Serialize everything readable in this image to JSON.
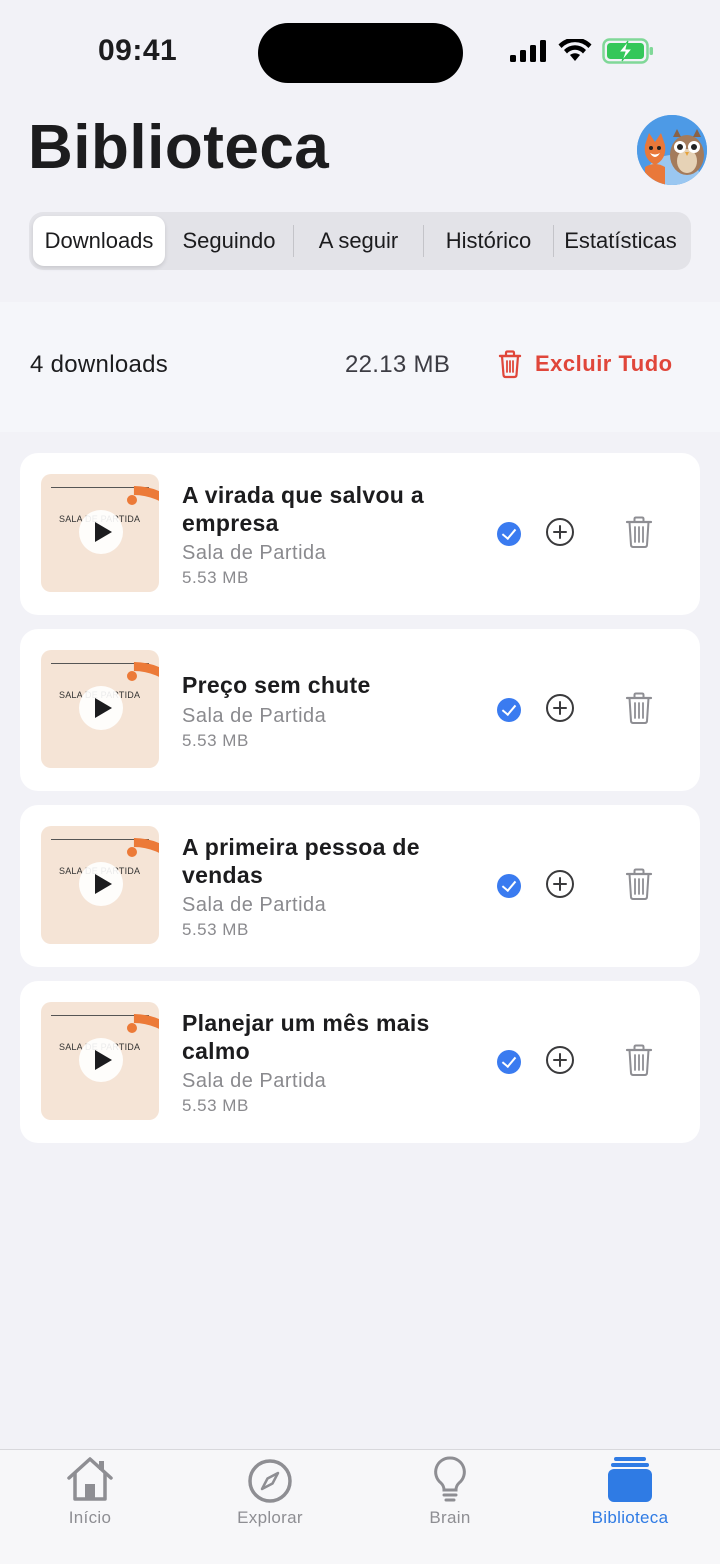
{
  "status_bar": {
    "time": "09:41"
  },
  "header": {
    "title": "Biblioteca"
  },
  "tabs": [
    {
      "label": "Downloads",
      "active": true
    },
    {
      "label": "Seguindo",
      "active": false
    },
    {
      "label": "A seguir",
      "active": false
    },
    {
      "label": "Histórico",
      "active": false
    },
    {
      "label": "Estatísticas",
      "active": false
    }
  ],
  "summary": {
    "count": "4 downloads",
    "total_size": "22.13 MB",
    "delete_all_label": "Excluir Tudo"
  },
  "episodes": [
    {
      "title": "A virada que salvou a empresa",
      "podcast": "Sala de Partida",
      "size": "5.53 MB",
      "thumb_text": "SALA DE PARTIDA",
      "downloaded": true
    },
    {
      "title": "Preço sem chute",
      "podcast": "Sala de Partida",
      "size": "5.53 MB",
      "thumb_text": "SALA DE PARTIDA",
      "downloaded": true
    },
    {
      "title": "A primeira pessoa de vendas",
      "podcast": "Sala de Partida",
      "size": "5.53 MB",
      "thumb_text": "SALA DE PARTIDA",
      "downloaded": true
    },
    {
      "title": "Planejar um mês mais calmo",
      "podcast": "Sala de Partida",
      "size": "5.53 MB",
      "thumb_text": "SALA DE PARTIDA",
      "downloaded": true
    }
  ],
  "tab_bar": {
    "items": [
      {
        "label": "Início",
        "icon": "home-icon",
        "active": false
      },
      {
        "label": "Explorar",
        "icon": "compass-icon",
        "active": false
      },
      {
        "label": "Brain",
        "icon": "lightbulb-icon",
        "active": false
      },
      {
        "label": "Biblioteca",
        "icon": "library-icon",
        "active": true
      }
    ]
  },
  "colors": {
    "accent": "#2f7be4",
    "destructive": "#e0463a",
    "thumbnail_orange": "#ec7a38",
    "battery_green": "#34c759"
  }
}
